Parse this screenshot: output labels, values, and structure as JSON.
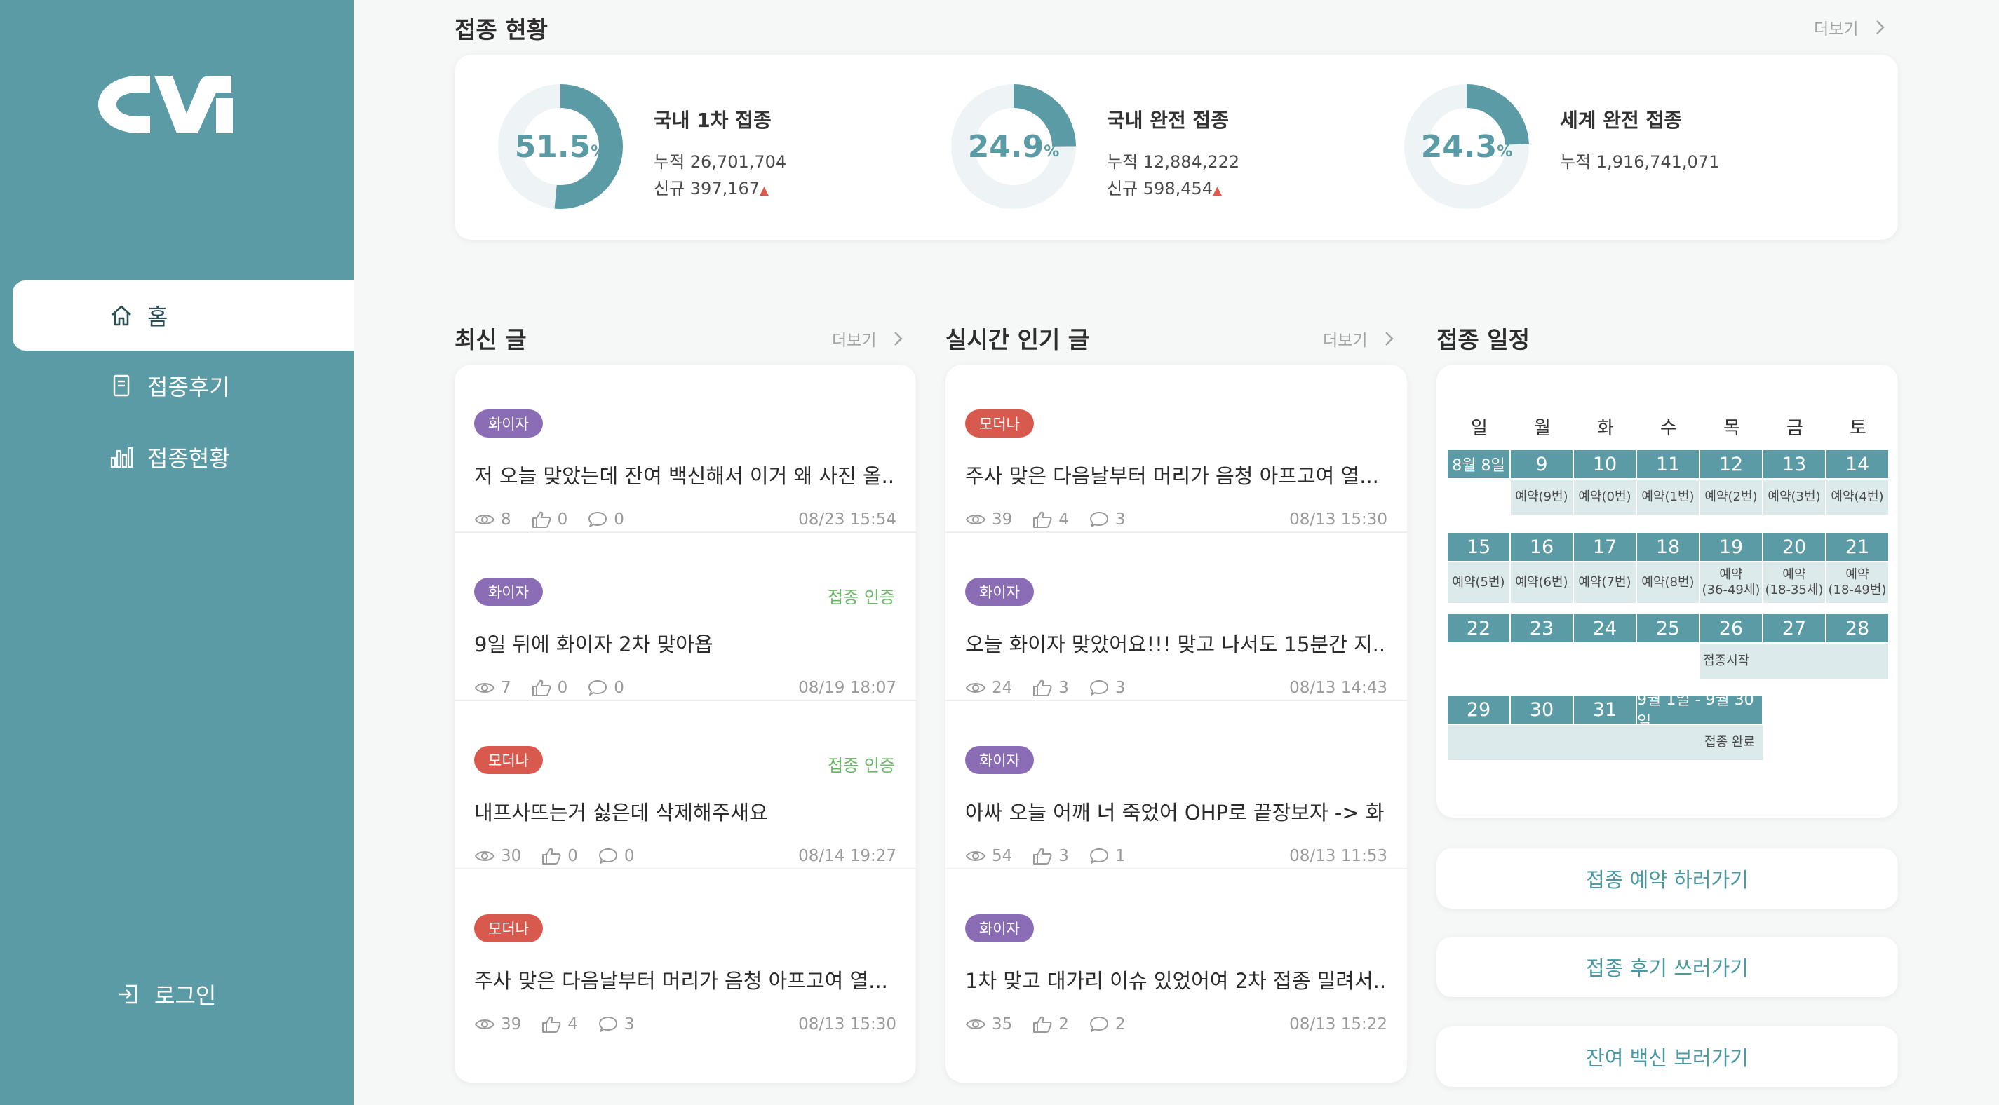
{
  "brand": {
    "logo_text": "CVI",
    "accent": "#5b9ba6",
    "bg": "#f6f7f7"
  },
  "nav": {
    "home": "홈",
    "review": "접종후기",
    "stats": "접종현황",
    "login": "로그인"
  },
  "status": {
    "title": "접종 현황",
    "more": "더보기",
    "items": [
      {
        "value": "51.5",
        "unit": "%",
        "percent": 51.5,
        "title": "국내 1차 접종",
        "cumulative": "누적 26,701,704",
        "new": "신규 397,167",
        "trend": "▲"
      },
      {
        "value": "24.9",
        "unit": "%",
        "percent": 24.9,
        "title": "국내 완전 접종",
        "cumulative": "누적 12,884,222",
        "new": "신규 598,454",
        "trend": "▲"
      },
      {
        "value": "24.3",
        "unit": "%",
        "percent": 24.3,
        "title": "세계 완전 접종",
        "cumulative": "누적 1,916,741,071"
      }
    ]
  },
  "latest": {
    "title": "최신 글",
    "more": "더보기",
    "posts": [
      {
        "badge": "화이자",
        "type": "pfizer",
        "cert": "",
        "title": "저 오늘 맞았는데 잔여 백신해서 이거 왜 사진 올...",
        "views": "8",
        "likes": "0",
        "comments": "0",
        "date": "08/23 15:54"
      },
      {
        "badge": "화이자",
        "type": "pfizer",
        "cert": "접종 인증",
        "title": "9일 뒤에 화이자 2차 맞아욥",
        "views": "7",
        "likes": "0",
        "comments": "0",
        "date": "08/19 18:07"
      },
      {
        "badge": "모더나",
        "type": "moderna",
        "cert": "접종 인증",
        "title": "내프사뜨는거 싫은데 삭제해주새요",
        "views": "30",
        "likes": "0",
        "comments": "0",
        "date": "08/14 19:27"
      },
      {
        "badge": "모더나",
        "type": "moderna",
        "cert": "",
        "title": "주사 맞은 다음날부터 머리가 음청 아프고여 열...",
        "views": "39",
        "likes": "4",
        "comments": "3",
        "date": "08/13 15:30"
      }
    ]
  },
  "popular": {
    "title": "실시간 인기 글",
    "more": "더보기",
    "posts": [
      {
        "badge": "모더나",
        "type": "moderna",
        "cert": "",
        "title": "주사 맞은 다음날부터 머리가 음청 아프고여 열...",
        "views": "39",
        "likes": "4",
        "comments": "3",
        "date": "08/13 15:30"
      },
      {
        "badge": "화이자",
        "type": "pfizer",
        "cert": "",
        "title": "오늘 화이자 맞았어요!!! 맞고 나서도 15분간 지...",
        "views": "24",
        "likes": "3",
        "comments": "3",
        "date": "08/13 14:43"
      },
      {
        "badge": "화이자",
        "type": "pfizer",
        "cert": "",
        "title": "아싸 오늘 어깨 너 죽었어 OHP로 끝장보자 -> 화...",
        "views": "54",
        "likes": "3",
        "comments": "1",
        "date": "08/13 11:53"
      },
      {
        "badge": "화이자",
        "type": "pfizer",
        "cert": "",
        "title": "1차 맞고 대가리 이슈 있었어여 2차 접종 밀려서...",
        "views": "35",
        "likes": "2",
        "comments": "2",
        "date": "08/13 15:22"
      }
    ]
  },
  "schedule": {
    "title": "접종 일정",
    "weekdays": [
      "일",
      "월",
      "화",
      "수",
      "목",
      "금",
      "토"
    ],
    "weeks": [
      {
        "days": [
          "8월 8일",
          "9",
          "10",
          "11",
          "12",
          "13",
          "14"
        ],
        "subs": [
          "",
          "예약(9번)",
          "예약(0번)",
          "예약(1번)",
          "예약(2번)",
          "예약(3번)",
          "예약(4번)"
        ]
      },
      {
        "days": [
          "15",
          "16",
          "17",
          "18",
          "19",
          "20",
          "21"
        ],
        "subs": [
          "예약(5번)",
          "예약(6번)",
          "예약(7번)",
          "예약(8번)",
          "예약\n(36-49세)",
          "예약\n(18-35세)",
          "예약\n(18-49번)"
        ]
      },
      {
        "days": [
          "22",
          "23",
          "24",
          "25",
          "26",
          "27",
          "28"
        ],
        "sub_note": "접종시작"
      },
      {
        "days": [
          "29",
          "30",
          "31",
          "9월 1일 - 9월 30일"
        ],
        "sub_note": "접종 완료"
      }
    ]
  },
  "actions": {
    "reserve": "접종 예약 하러가기",
    "write_review": "접종 후기 쓰러가기",
    "leftover": "잔여 백신 보러가기"
  }
}
